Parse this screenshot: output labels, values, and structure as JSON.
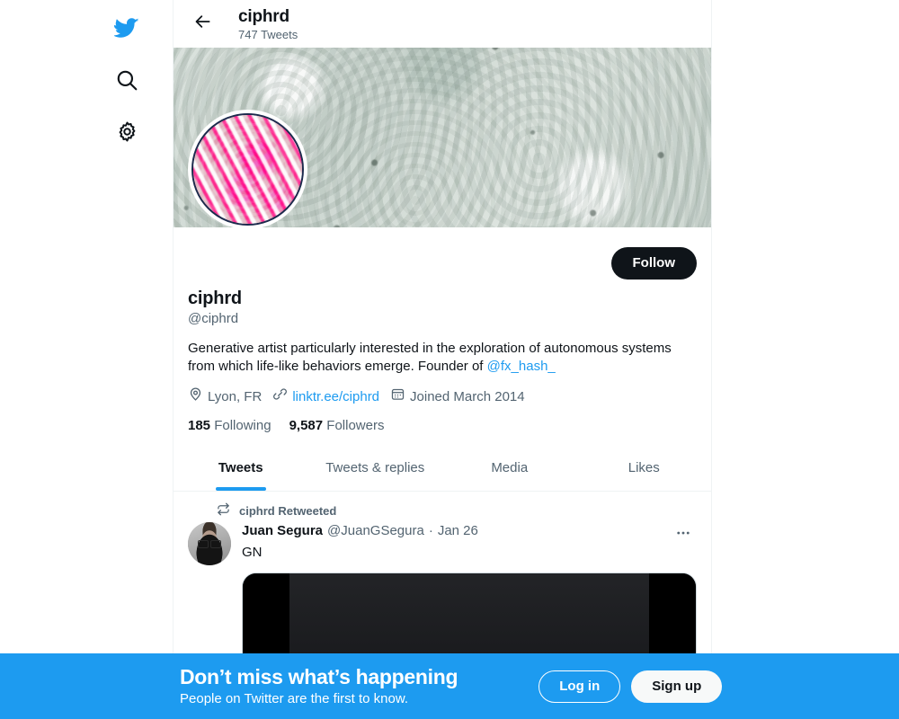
{
  "sidebar": {
    "items": [
      {
        "name": "twitter-logo",
        "icon": "twitter-bird-icon",
        "color": "#1d9bf0"
      },
      {
        "name": "search",
        "icon": "search-icon",
        "color": "#0f1419"
      },
      {
        "name": "settings",
        "icon": "gear-icon",
        "color": "#0f1419"
      }
    ]
  },
  "header": {
    "back_icon": "arrow-left-icon",
    "title": "ciphrd",
    "tweet_count": "747 Tweets"
  },
  "profile": {
    "follow_label": "Follow",
    "display_name": "ciphrd",
    "handle": "@ciphrd",
    "bio_part1": "Generative artist particularly interested in the exploration of autonomous systems from which life-like behaviors emerge. Founder of ",
    "bio_mention": "@fx_hash_",
    "location": "Lyon, FR",
    "website": "linktr.ee/ciphrd",
    "joined": "Joined March 2014",
    "following_count": "185",
    "following_label": "Following",
    "followers_count": "9,587",
    "followers_label": "Followers"
  },
  "tabs": [
    {
      "label": "Tweets",
      "active": true
    },
    {
      "label": "Tweets & replies",
      "active": false
    },
    {
      "label": "Media",
      "active": false
    },
    {
      "label": "Likes",
      "active": false
    }
  ],
  "tweet": {
    "retweet_label": "ciphrd Retweeted",
    "author_name": "Juan Segura",
    "author_handle": "@JuanGSegura",
    "separator": "·",
    "date": "Jan 26",
    "text": "GN",
    "more_label": "···"
  },
  "signup_banner": {
    "title": "Don’t miss what’s happening",
    "subtitle": "People on Twitter are the first to know.",
    "login_label": "Log in",
    "signup_label": "Sign up"
  },
  "colors": {
    "accent": "#1d9bf0",
    "text_primary": "#0f1419",
    "text_secondary": "#536471",
    "follow_button": "#0f1419"
  }
}
